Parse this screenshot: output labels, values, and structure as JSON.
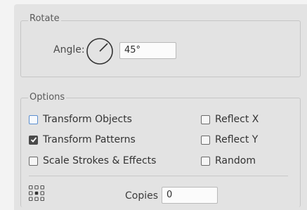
{
  "rotate": {
    "title": "Rotate",
    "angle_label": "Angle:",
    "angle_value": "45°"
  },
  "options": {
    "title": "Options",
    "checkboxes_left": [
      {
        "label": "Transform Objects",
        "checked": false,
        "focused": true
      },
      {
        "label": "Transform Patterns",
        "checked": true,
        "focused": false
      },
      {
        "label": "Scale Strokes & Effects",
        "checked": false,
        "focused": false
      }
    ],
    "checkboxes_right": [
      {
        "label": "Reflect X",
        "checked": false
      },
      {
        "label": "Reflect Y",
        "checked": false
      },
      {
        "label": "Random",
        "checked": false
      }
    ]
  },
  "copies": {
    "label": "Copies",
    "value": "0"
  },
  "icons": {
    "angle_dial": "rotation-dial-icon",
    "reference_point": "reference-point-grid-icon"
  },
  "colors": {
    "focus_blue": "#5b8fd0",
    "panel_bg": "#e3e3e3"
  }
}
